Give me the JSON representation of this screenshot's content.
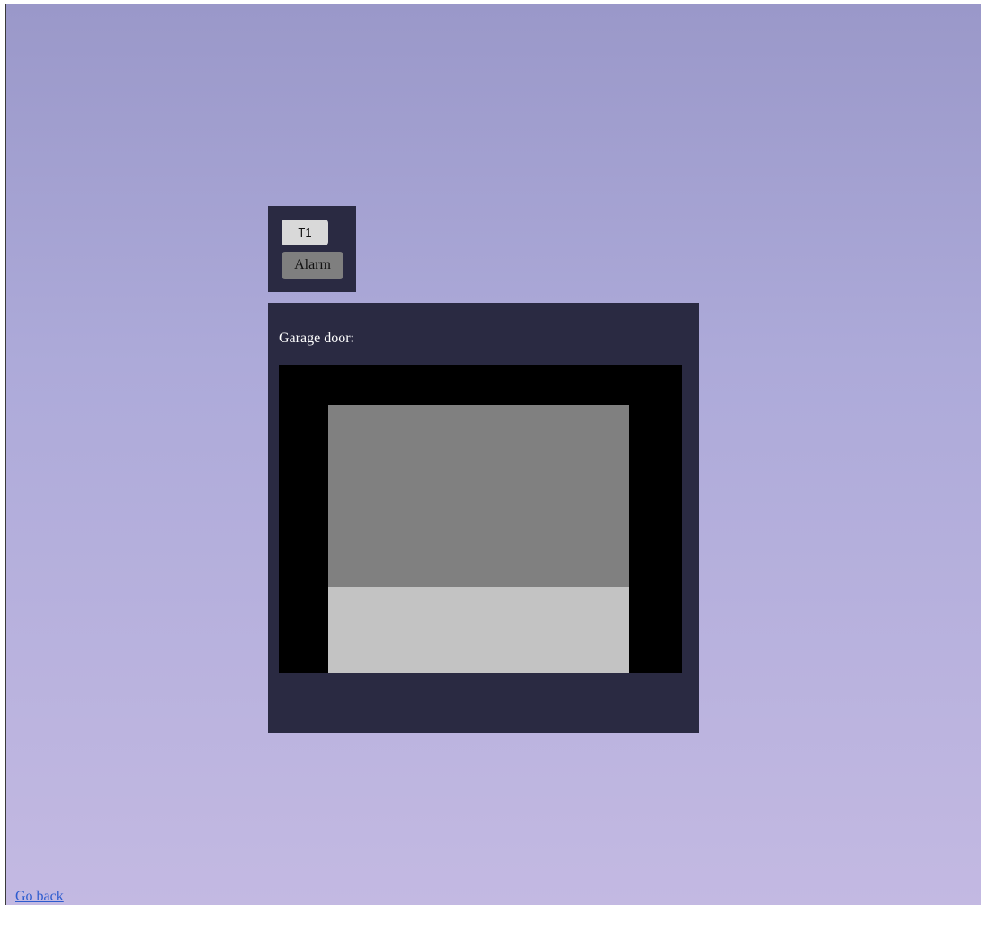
{
  "tabs": {
    "t1_label": "T1",
    "alarm_label": "Alarm"
  },
  "garage": {
    "label": "Garage door:",
    "door_closed_fraction": 0.68
  },
  "nav": {
    "go_back_label": "Go back"
  },
  "colors": {
    "panel_bg": "#2a2a42",
    "frame_bg": "#000000",
    "door_closed": "#808080",
    "door_open": "#c3c3c3",
    "link": "#2d5ccf"
  }
}
